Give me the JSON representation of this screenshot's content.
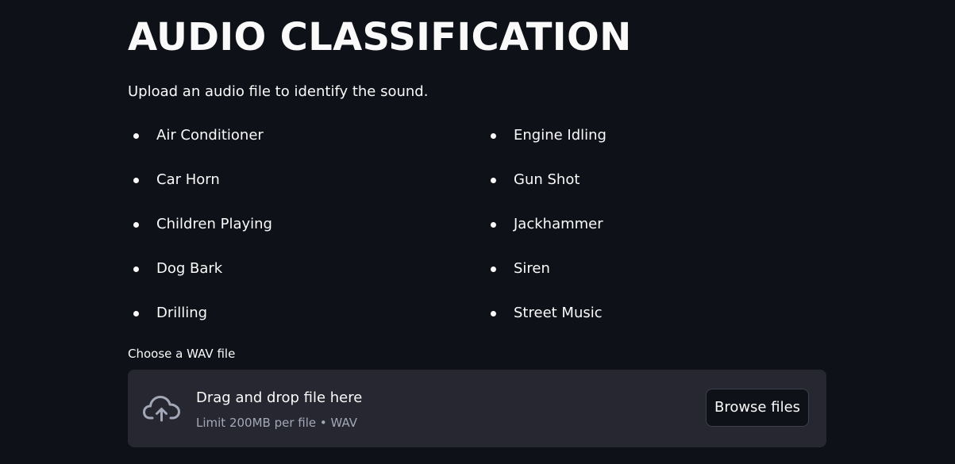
{
  "header": {
    "title": "AUDIO CLASSIFICATION",
    "subtitle": "Upload an audio file to identify the sound."
  },
  "classes": {
    "left": [
      "Air Conditioner",
      "Car Horn",
      "Children Playing",
      "Dog Bark",
      "Drilling"
    ],
    "right": [
      "Engine Idling",
      "Gun Shot",
      "Jackhammer",
      "Siren",
      "Street Music"
    ]
  },
  "uploader": {
    "label": "Choose a WAV file",
    "drop_text": "Drag and drop file here",
    "limit_text": "Limit 200MB per file • WAV",
    "browse_label": "Browse files",
    "icon": "cloud-upload-icon"
  },
  "colors": {
    "background": "#0e1117",
    "dropzone": "#262730",
    "text": "#fafafa",
    "muted_text": "#a3a8b8"
  }
}
